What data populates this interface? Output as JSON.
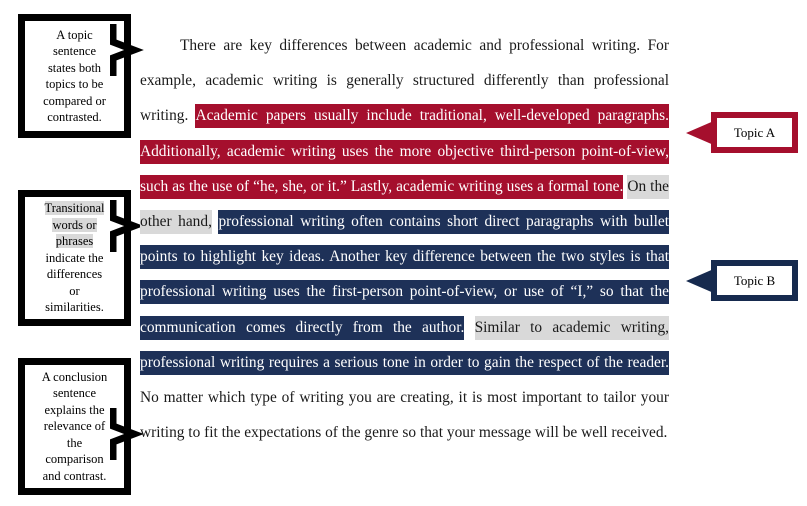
{
  "document": {
    "type": "compare-contrast-paragraph-annotated-diagram"
  },
  "colors": {
    "topic_a_red": "#a50f2d",
    "topic_b_navy": "#1e3158",
    "transition_gray": "#d9d9d9",
    "box_border_black": "#000000",
    "page_background": "#ffffff"
  },
  "annotation_boxes": [
    {
      "id": "topic-sentence-note",
      "lines": [
        "A topic",
        "sentence",
        "states both",
        "topics to be",
        "compared or",
        "contrasted."
      ],
      "highlighted_lines": []
    },
    {
      "id": "transition-note",
      "lines": [
        "Transitional",
        "words or",
        "phrases",
        "indicate the",
        "differences",
        "or",
        "similarities."
      ],
      "highlighted_lines": [
        "Transitional",
        "words or",
        "phrases"
      ]
    },
    {
      "id": "conclusion-note",
      "lines": [
        "A conclusion",
        "sentence",
        "explains the",
        "relevance of",
        "the",
        "comparison",
        "and contrast."
      ],
      "highlighted_lines": []
    }
  ],
  "topic_callouts": [
    {
      "id": "topic-a",
      "label": "Topic A",
      "color": "#a50f2d"
    },
    {
      "id": "topic-b",
      "label": "Topic B",
      "color": "#162a4e"
    }
  ],
  "paragraph": {
    "segments": [
      {
        "style": "plain",
        "text": "There are key differences between academic and professional writing. For example, academic writing is generally structured differently than professional writing. "
      },
      {
        "style": "red",
        "text": "Academic papers usually include traditional, well-developed paragraphs. Additionally, academic writing uses the more objective third-person point-of-view, such as the use of “he, she, or it.” Lastly, academic writing uses a formal tone."
      },
      {
        "style": "plain",
        "text": " "
      },
      {
        "style": "gray",
        "text": "On the other hand,"
      },
      {
        "style": "plain",
        "text": " "
      },
      {
        "style": "navy",
        "text": "professional writing often contains short direct paragraphs with bullet points to highlight key ideas. Another key difference between the two styles is that professional writing uses the first-person point-of-view, or use of “I,” so that the communication comes directly from the author."
      },
      {
        "style": "plain",
        "text": " "
      },
      {
        "style": "gray",
        "text": "Similar to academic writing,"
      },
      {
        "style": "plain",
        "text": " "
      },
      {
        "style": "navy",
        "text": "professional writing requires a serious tone in order to gain the respect of the reader."
      },
      {
        "style": "plain",
        "text": " No matter which type of writing you are creating, it is most important to tailor your writing to fit the expectations of the genre so that your message will be well received."
      }
    ],
    "full_text": "There are key differences between academic and professional writing. For example, academic writing is generally structured differently than professional writing. Academic papers usually include traditional, well-developed paragraphs. Additionally, academic writing uses the more objective third-person point-of-view, such as the use of “he, she, or it.” Lastly, academic writing uses a formal tone. On the other hand, professional writing often contains short direct paragraphs with bullet points to highlight key ideas. Another key difference between the two styles is that professional writing uses the first-person point-of-view, or use of “I,” so that the communication comes directly from the author. Similar to academic writing, professional writing requires a serious tone in order to gain the respect of the reader. No matter which type of writing you are creating, it is most important to tailor your writing to fit the expectations of the genre so that your message will be well received."
  }
}
